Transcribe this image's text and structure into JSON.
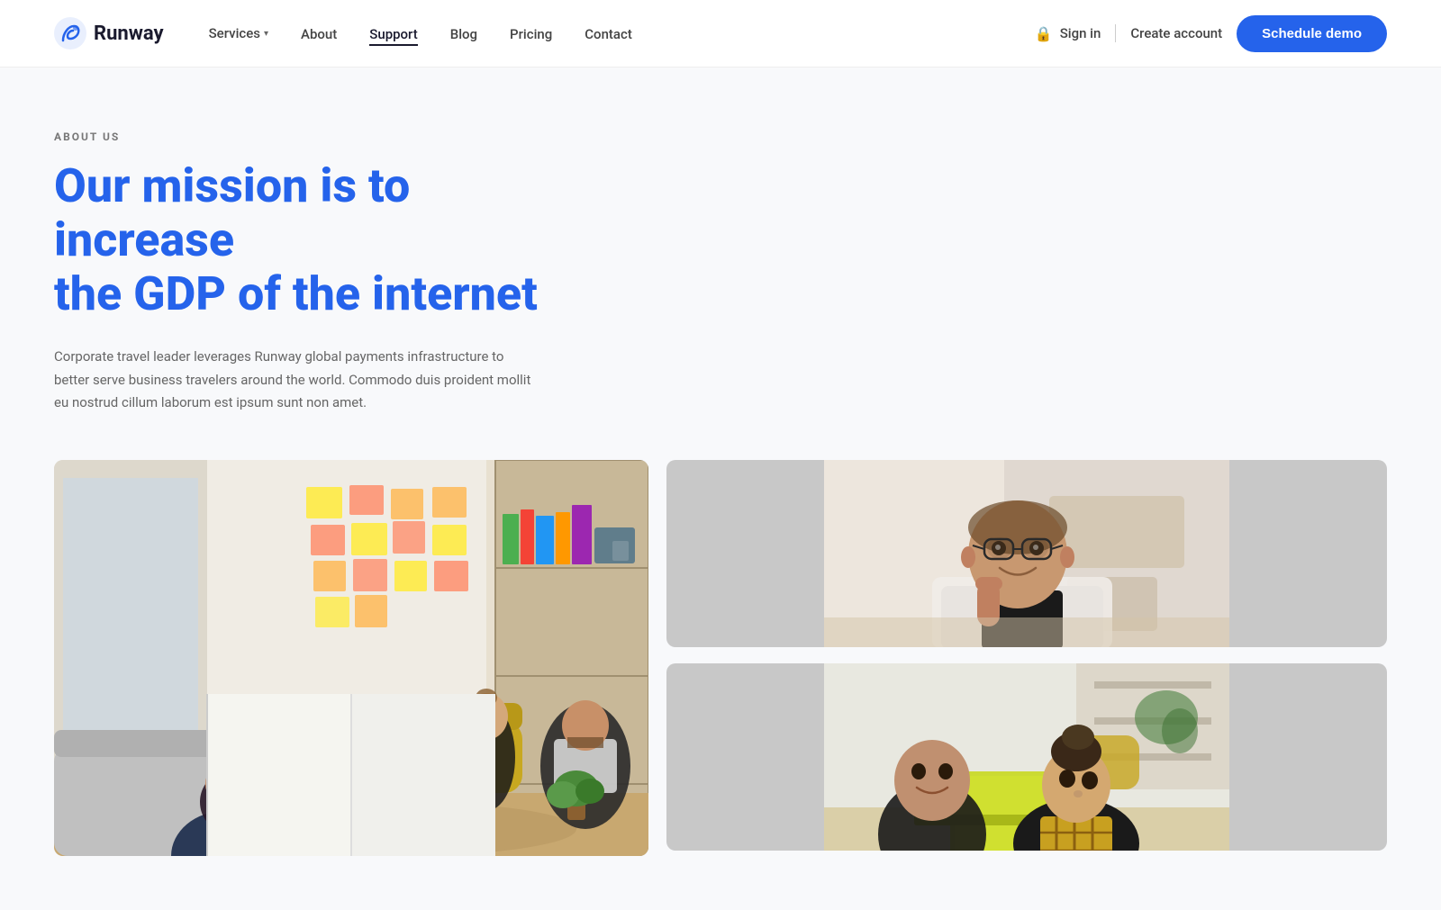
{
  "brand": {
    "name": "Runway",
    "logo_alt": "Runway logo"
  },
  "navbar": {
    "links": [
      {
        "label": "Services",
        "has_dropdown": true,
        "active": false
      },
      {
        "label": "About",
        "has_dropdown": false,
        "active": false
      },
      {
        "label": "Support",
        "has_dropdown": false,
        "active": true
      },
      {
        "label": "Blog",
        "has_dropdown": false,
        "active": false
      },
      {
        "label": "Pricing",
        "has_dropdown": false,
        "active": false
      },
      {
        "label": "Contact",
        "has_dropdown": false,
        "active": false
      }
    ],
    "sign_in": "Sign in",
    "create_account": "Create account",
    "schedule_demo": "Schedule demo"
  },
  "hero": {
    "eyebrow": "ABOUT US",
    "heading_line1": "Our mission is to increase",
    "heading_line2": "the GDP of the internet",
    "description": "Corporate travel leader leverages Runway global payments infrastructure to better serve business travelers around the world. Commodo duis proident mollit eu nostrud cillum laborum est ipsum sunt non amet."
  },
  "photos": {
    "large_alt": "Team meeting in office with sticky notes on wall",
    "small_top_alt": "Man smiling with glasses",
    "small_bottom_alt": "Two colleagues working together with laptop"
  },
  "colors": {
    "accent": "#2563eb",
    "text_dark": "#1a1a2e",
    "text_gray": "#666666",
    "text_label": "#777777"
  }
}
